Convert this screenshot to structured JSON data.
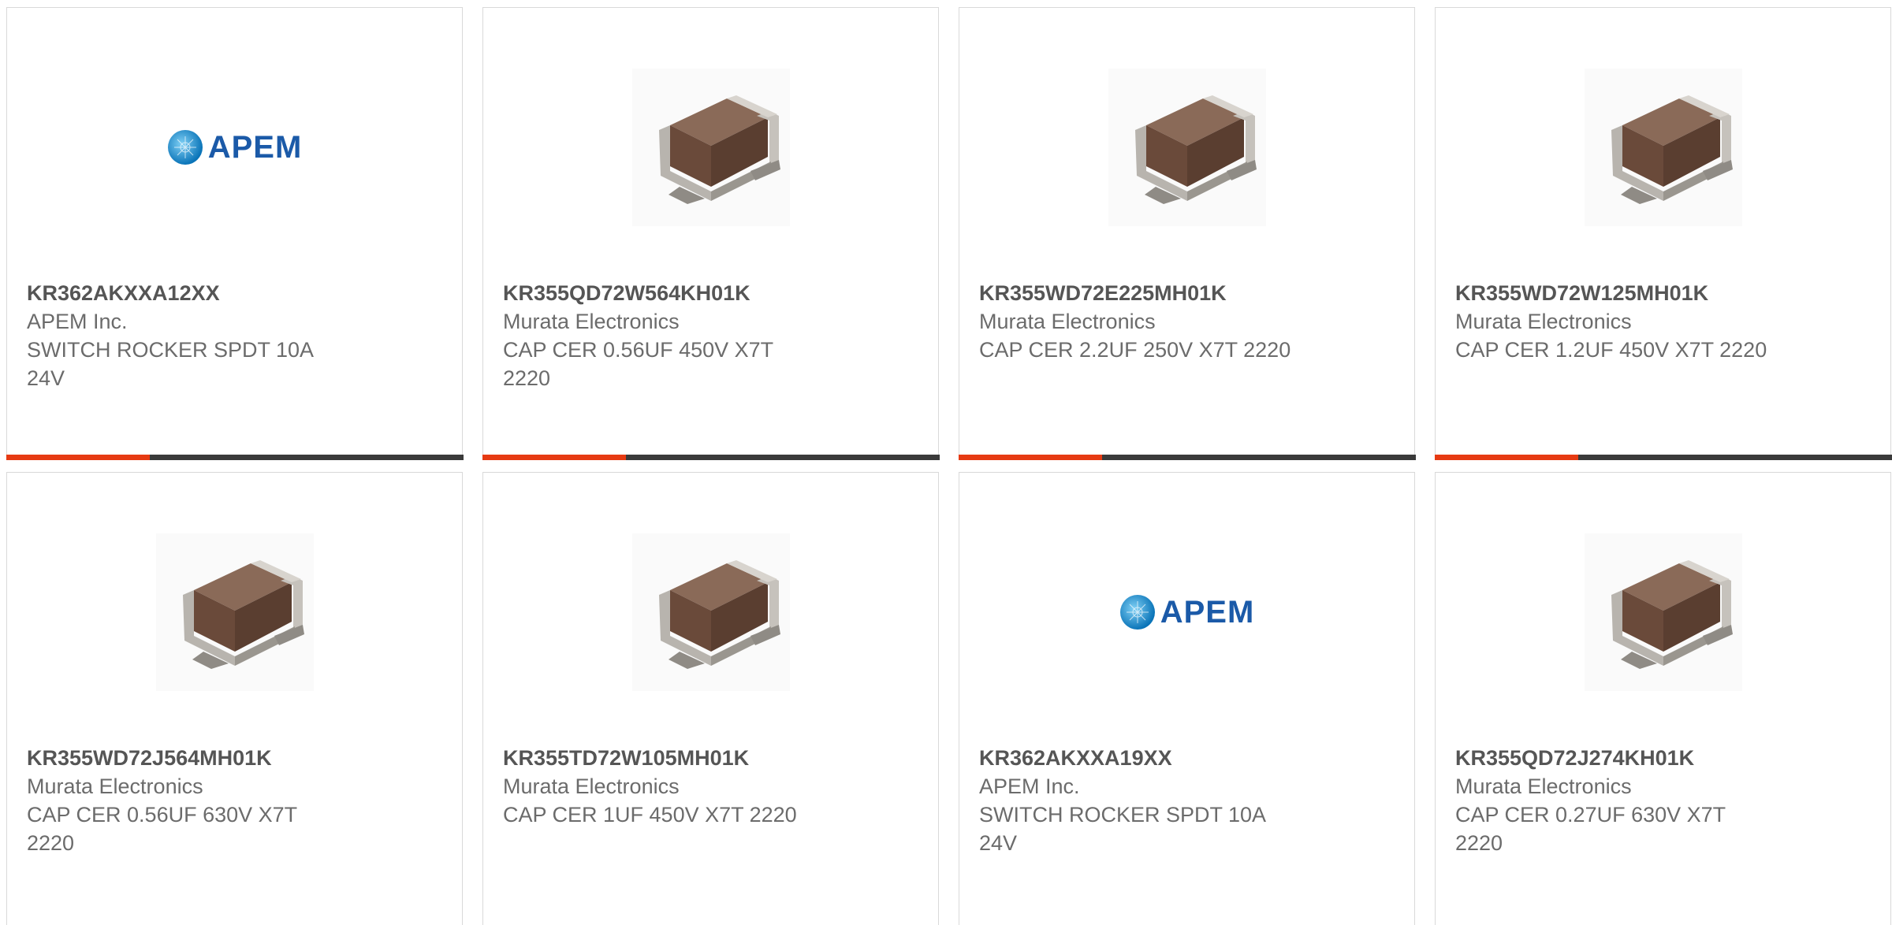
{
  "colors": {
    "accent": "#e63a12",
    "bar": "#3a3a3a",
    "border": "#d9d9d9",
    "apem_blue": "#1b5aa8"
  },
  "products": [
    {
      "part_number": "KR362AKXXA12XX",
      "manufacturer": "APEM Inc.",
      "description": "SWITCH ROCKER SPDT 10A 24V",
      "image": "apem-logo",
      "logo_text": "APEM"
    },
    {
      "part_number": "KR355QD72W564KH01K",
      "manufacturer": "Murata Electronics",
      "description": "CAP CER 0.56UF 450V X7T 2220",
      "image": "capacitor-image"
    },
    {
      "part_number": "KR355WD72E225MH01K",
      "manufacturer": "Murata Electronics",
      "description": "CAP CER 2.2UF 250V X7T 2220",
      "image": "capacitor-image"
    },
    {
      "part_number": "KR355WD72W125MH01K",
      "manufacturer": "Murata Electronics",
      "description": "CAP CER 1.2UF 450V X7T 2220",
      "image": "capacitor-image"
    },
    {
      "part_number": "KR355WD72J564MH01K",
      "manufacturer": "Murata Electronics",
      "description": "CAP CER 0.56UF 630V X7T 2220",
      "image": "capacitor-image"
    },
    {
      "part_number": "KR355TD72W105MH01K",
      "manufacturer": "Murata Electronics",
      "description": "CAP CER 1UF 450V X7T 2220",
      "image": "capacitor-image"
    },
    {
      "part_number": "KR362AKXXA19XX",
      "manufacturer": "APEM Inc.",
      "description": "SWITCH ROCKER SPDT 10A 24V",
      "image": "apem-logo",
      "logo_text": "APEM"
    },
    {
      "part_number": "KR355QD72J274KH01K",
      "manufacturer": "Murata Electronics",
      "description": "CAP CER 0.27UF 630V X7T 2220",
      "image": "capacitor-image"
    }
  ]
}
